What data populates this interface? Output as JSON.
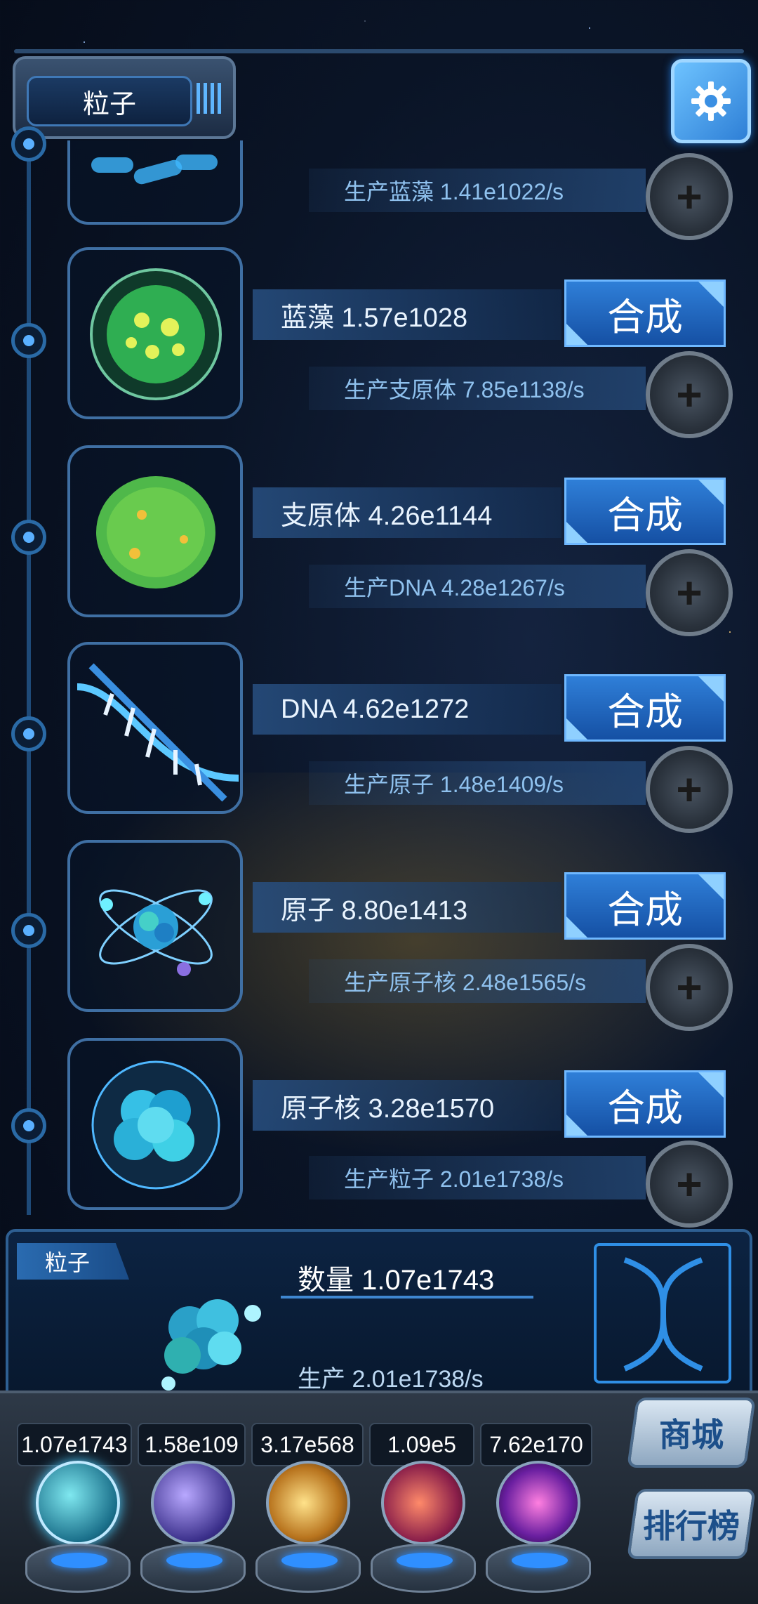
{
  "header": {
    "title": "粒子",
    "settings_icon": "gear-icon"
  },
  "rows": [
    {
      "name": "",
      "produce": "生产蓝藻 1.41e1022/s",
      "icon": "bacteria-icon"
    },
    {
      "name": "蓝藻 1.57e1028",
      "craft": "合成",
      "produce": "生产支原体 7.85e1138/s",
      "icon": "cyanobacteria-icon"
    },
    {
      "name": "支原体 4.26e1144",
      "craft": "合成",
      "produce": "生产DNA 4.28e1267/s",
      "icon": "mycoplasma-icon"
    },
    {
      "name": "DNA 4.62e1272",
      "craft": "合成",
      "produce": "生产原子 1.48e1409/s",
      "icon": "dna-icon"
    },
    {
      "name": "原子 8.80e1413",
      "craft": "合成",
      "produce": "生产原子核 2.48e1565/s",
      "icon": "atom-icon"
    },
    {
      "name": "原子核 3.28e1570",
      "craft": "合成",
      "produce": "生产粒子 2.01e1738/s",
      "icon": "nucleus-icon"
    }
  ],
  "info": {
    "tag": "粒子",
    "count": "数量 1.07e1743",
    "produce": "生产 2.01e1738/s",
    "icon": "particle-cluster-icon"
  },
  "dock": {
    "values": [
      "1.07e1743",
      "1.58e109",
      "3.17e568",
      "1.09e5",
      "7.62e170"
    ],
    "orbs": [
      "particle-orb-icon",
      "lightning-orb-icon",
      "galaxy-orb-icon",
      "brain-orb-icon",
      "vortex-orb-icon"
    ],
    "shop": "商城",
    "ranking": "排行榜"
  },
  "colors": {
    "accent": "#2f7fd8",
    "frame": "#3f6fa3",
    "background": "#0a1426"
  }
}
